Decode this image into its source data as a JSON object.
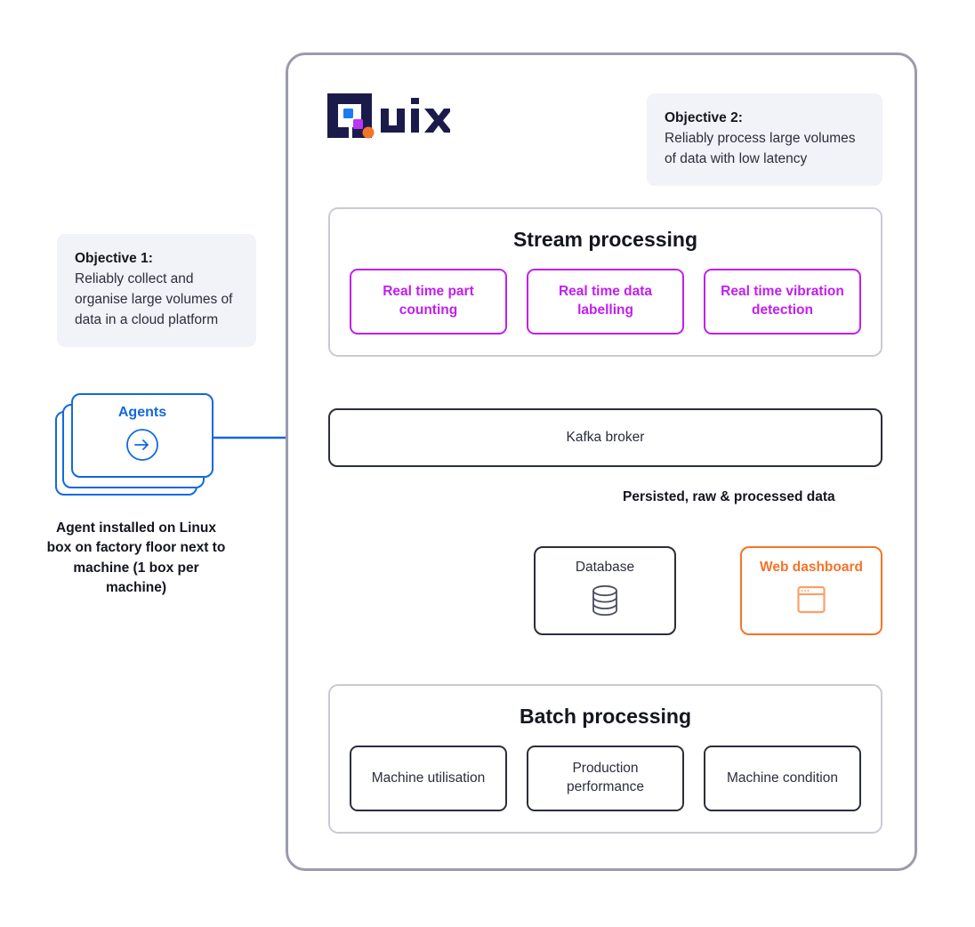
{
  "brand": {
    "logo_name": "quix-logo",
    "logo_text": "uix",
    "navy": "#1b1b4b",
    "blue": "#1268e3",
    "purple": "#c01ff0",
    "orange": "#f57328"
  },
  "objectives": [
    {
      "id": "objective-1",
      "title": "Objective 1:",
      "body": "Reliably collect and organise large volumes of data in a cloud platform"
    },
    {
      "id": "objective-2",
      "title": "Objective 2:",
      "body": "Reliably process large volumes of data with low latency"
    }
  ],
  "agents": {
    "title": "Agents",
    "icon": "circle-arrow-right-icon",
    "caption": "Agent installed on Linux box on factory floor next to machine (1 box per machine)",
    "color": "#1268e3"
  },
  "stream_processing": {
    "title": "Stream processing",
    "color": "#c01ff0",
    "chips": [
      "Real time part counting",
      "Real time data labelling",
      "Real time vibration detection"
    ]
  },
  "kafka": {
    "label": "Kafka broker"
  },
  "connectors": {
    "persisted_label": "Persisted, raw & processed data"
  },
  "database": {
    "label": "Database",
    "icon": "database-cylinder-icon"
  },
  "dashboard": {
    "label": "Web dashboard",
    "icon": "browser-window-icon",
    "color": "#f57328"
  },
  "batch_processing": {
    "title": "Batch processing",
    "chips": [
      "Machine utilisation",
      "Production performance",
      "Machine condition"
    ]
  }
}
